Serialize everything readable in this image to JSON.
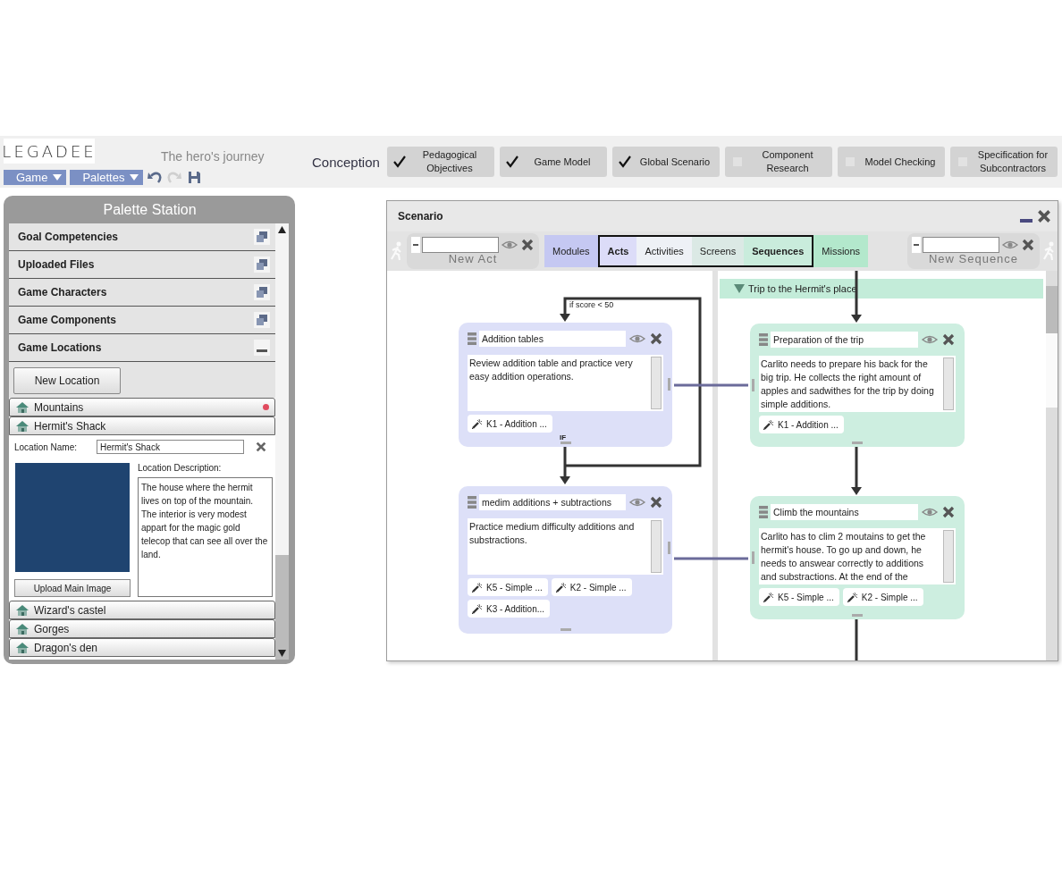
{
  "header": {
    "logo": "LEGADEE",
    "project_title": "The hero's journey",
    "menus": [
      {
        "label": "Game"
      },
      {
        "label": "Palettes"
      }
    ],
    "tools": [
      {
        "kind": "undo",
        "disabled": false
      },
      {
        "kind": "redo",
        "disabled": true
      },
      {
        "kind": "save",
        "disabled": false
      }
    ],
    "phase_label": "Conception",
    "phases": [
      {
        "label": "Pedagogical Objectives",
        "checked": true
      },
      {
        "label": "Game Model",
        "checked": true
      },
      {
        "label": "Global Scenario",
        "checked": true
      },
      {
        "label": "Component Research",
        "checked": false
      },
      {
        "label": "Model Checking",
        "checked": false
      },
      {
        "label": "Specification for Subcontractors",
        "checked": false
      }
    ]
  },
  "palette": {
    "title": "Palette Station",
    "sections": [
      {
        "label": "Goal Competencies",
        "expanded": false
      },
      {
        "label": "Uploaded Files",
        "expanded": false
      },
      {
        "label": "Game Characters",
        "expanded": false
      },
      {
        "label": "Game Components",
        "expanded": false
      },
      {
        "label": "Game Locations",
        "expanded": true
      }
    ],
    "new_location_button": "New Location",
    "locations": [
      {
        "name": "Mountains",
        "expanded": false,
        "dot": true
      },
      {
        "name": "Hermit's Shack",
        "expanded": true,
        "dot": false
      },
      {
        "name": "Wizard's castel",
        "expanded": false,
        "dot": false
      },
      {
        "name": "Gorges",
        "expanded": false,
        "dot": false
      },
      {
        "name": "Dragon's den",
        "expanded": false,
        "dot": false
      }
    ],
    "location_detail": {
      "name_label": "Location Name:",
      "name_value": "Hermit's Shack",
      "description_label": "Location Description:",
      "description": "The house where the hermit lives on top of the mountain. The interior is very modest appart for the magic gold telecop that can see all over the land.",
      "upload_button": "Upload Main Image"
    }
  },
  "scenario": {
    "title": "Scenario",
    "left_tool": {
      "caption": "New Act"
    },
    "right_tool": {
      "caption": "New Sequence"
    },
    "levels": [
      {
        "label": "Modules",
        "color": "#c5c8f2",
        "selected": false,
        "in_scope": false
      },
      {
        "label": "Acts",
        "color": "#dcdcf8",
        "selected": true,
        "in_scope": true
      },
      {
        "label": "Activities",
        "color": "#eef1f6",
        "selected": false,
        "in_scope": true
      },
      {
        "label": "Screens",
        "color": "#dbe9e5",
        "selected": false,
        "in_scope": true
      },
      {
        "label": "Sequences",
        "color": "#c9ecdc",
        "selected": true,
        "in_scope": true
      },
      {
        "label": "Missions",
        "color": "#b3e8cc",
        "selected": false,
        "in_scope": false
      }
    ],
    "condition": "if score < 50",
    "branch_label": "IF",
    "acts": [
      {
        "title": "Addition tables",
        "description": "Review addition table and practice very easy addition operations.",
        "competencies": [
          "K1 - Addition ..."
        ]
      },
      {
        "title": "medim additions + subtractions",
        "description": "Practice medium difficulty additions and substractions.",
        "competencies": [
          "K5 - Simple ...",
          "K2 - Simple ...",
          "K3 - Addition..."
        ]
      }
    ],
    "sequence_group": {
      "title": "Trip to the Hermit's place",
      "expanded": true
    },
    "sequences": [
      {
        "title": "Preparation of the trip",
        "description": "Carlito needs to prepare his back for the big trip. He collects the right amount of apples and sadwithes for the trip by doing simple additions.",
        "competencies": [
          "K1 - Addition ..."
        ]
      },
      {
        "title": "Climb the mountains",
        "description": "Carlito has to clim 2 moutains to get the hermit's house. To go up and down, he needs to answear correctly to additions and substractions. At the end of the",
        "competencies": [
          "K5 - Simple ...",
          "K2 - Simple ..."
        ]
      }
    ]
  }
}
